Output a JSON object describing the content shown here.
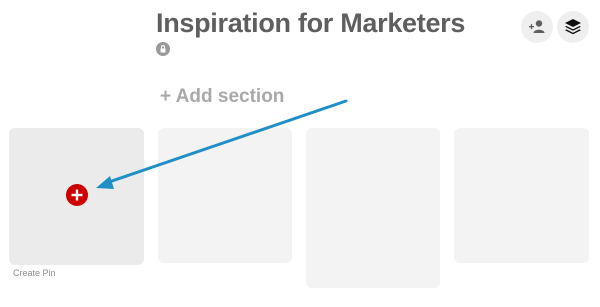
{
  "board": {
    "title": "Inspiration for Marketers",
    "privacy_icon": "lock-icon"
  },
  "header": {
    "collaborator_icon": "add-collaborator-icon",
    "layers_icon": "layers-icon"
  },
  "add_section": {
    "icon": "plus-icon",
    "label": "+ Add section"
  },
  "create_pin": {
    "icon": "plus-circle-icon",
    "label": "Create Pin"
  },
  "colors": {
    "accent_red": "#cc0000",
    "arrow_blue": "#1f8fc6"
  }
}
